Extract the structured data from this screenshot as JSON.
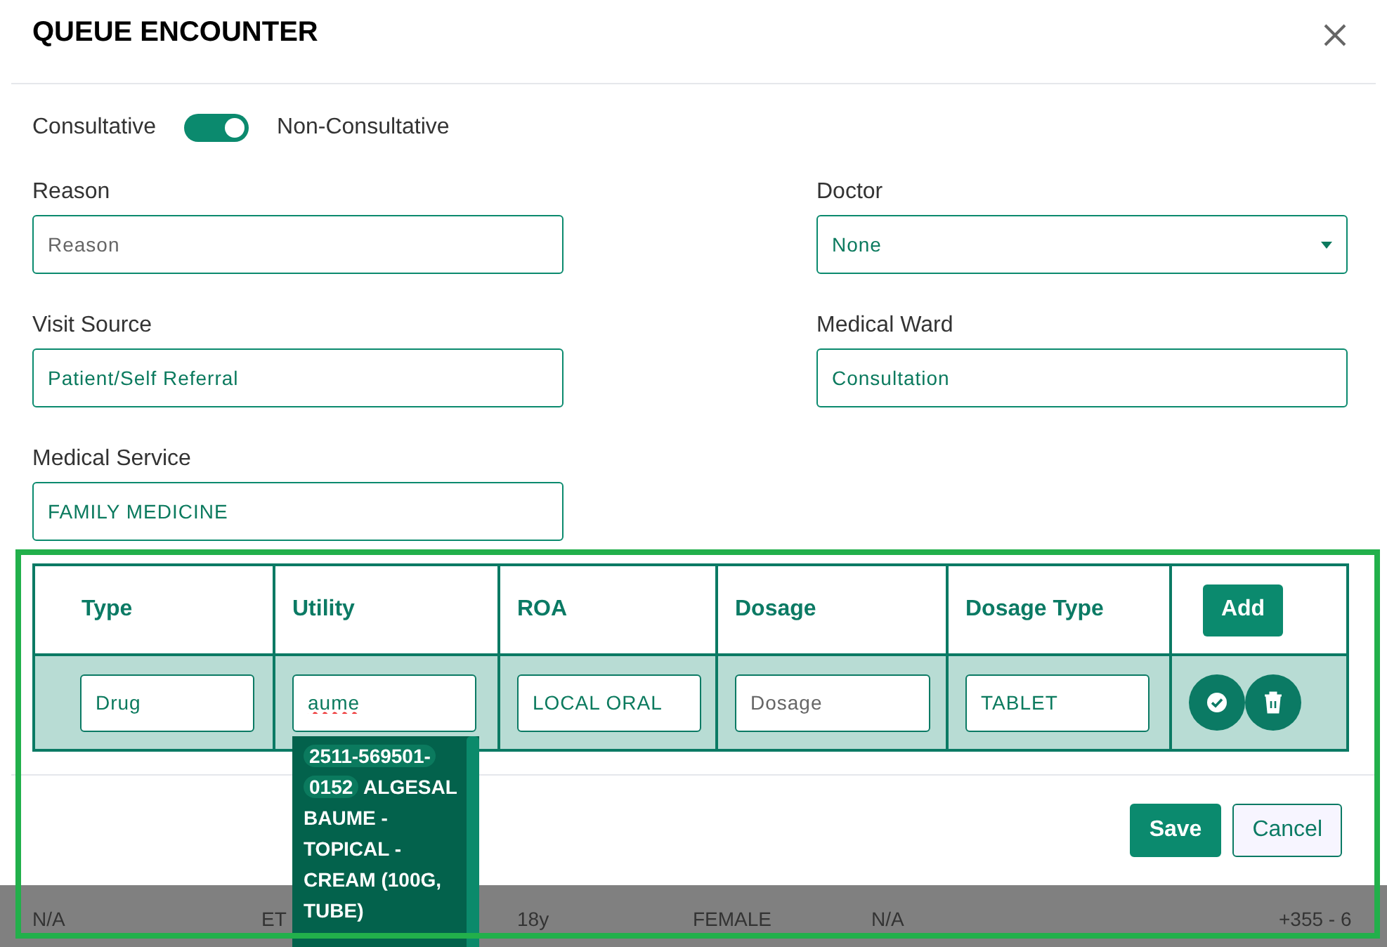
{
  "dialog": {
    "title": "QUEUE ENCOUNTER",
    "toggle": {
      "left_label": "Consultative",
      "right_label": "Non-Consultative",
      "on": true
    },
    "fields": [
      {
        "label": "Reason",
        "kind": "text",
        "placeholder": "Reason"
      },
      {
        "label": "Doctor",
        "kind": "select",
        "value": "None"
      },
      {
        "label": "Visit Source",
        "kind": "text",
        "value": "Patient/Self Referral"
      },
      {
        "label": "Medical Ward",
        "kind": "text",
        "value": "Consultation"
      },
      {
        "label": "Medical Service",
        "kind": "text",
        "value": "FAMILY MEDICINE"
      }
    ],
    "table": {
      "columns": [
        "Type",
        "Utility",
        "ROA",
        "Dosage",
        "Dosage Type"
      ],
      "add_button": "Add",
      "rows": [
        {
          "cells": [
            {
              "value": "Drug"
            },
            {
              "value": "aume",
              "misspelled": true
            },
            {
              "value": "LOCAL ORAL"
            },
            {
              "placeholder": "Dosage"
            },
            {
              "value": "TABLET"
            }
          ]
        }
      ]
    },
    "suggestions": [
      {
        "code": "2511-569501-0152",
        "name": "ALGESAL BAUME - TOPICAL - CREAM (100G, TUBE)"
      }
    ],
    "buttons": [
      {
        "label": "Save",
        "kind": "primary"
      },
      {
        "label": "Cancel",
        "kind": "secondary"
      }
    ]
  },
  "background_row": [
    "N/A",
    "ET",
    "18y",
    "FEMALE",
    "N/A",
    "+355 - 6"
  ]
}
